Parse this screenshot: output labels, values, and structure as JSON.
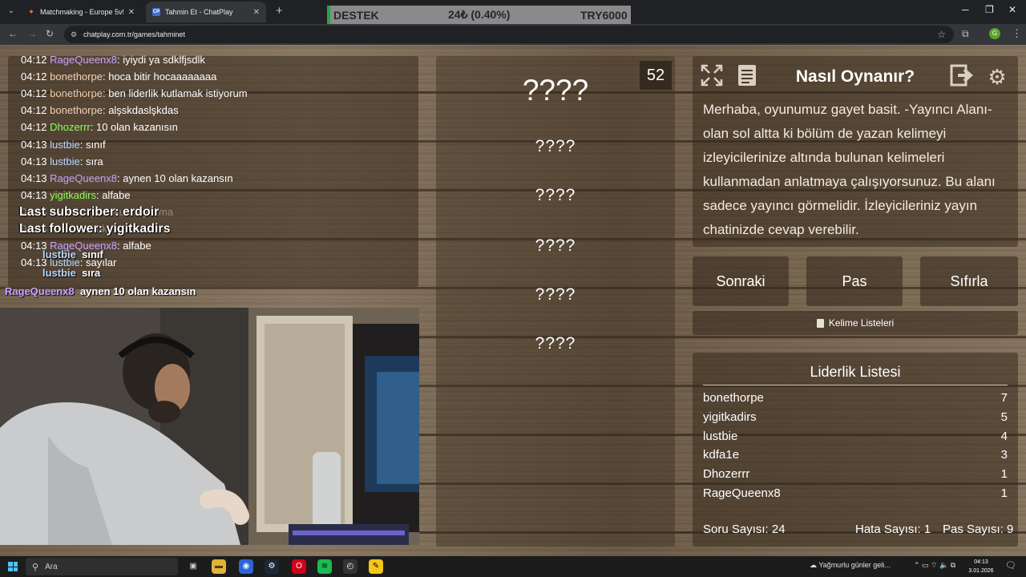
{
  "browser": {
    "tabs": [
      {
        "label": "Matchmaking - Europe 5v5 Qu",
        "favicon": "◆",
        "favicon_color": "#e46b2b"
      },
      {
        "label": "Tahmin Et - ChatPlay",
        "favicon": "CP",
        "favicon_color": "#3b6fd6"
      }
    ],
    "url": "chatplay.com.tr/games/tahminet",
    "profile_initial": "G"
  },
  "ticker": {
    "label": "DESTEK",
    "amount": "24₺ (0.40%)",
    "goal": "TRY6000"
  },
  "chat": {
    "lines": [
      {
        "time": "04:12",
        "user": "RageQueenx8",
        "color": "#c8a2ff",
        "msg": "iyiydi ya sdklfjsdlk"
      },
      {
        "time": "04:12",
        "user": "bonethorpe",
        "color": "#f0d2b6",
        "msg": "hoca bitir hocaaaaaaaa"
      },
      {
        "time": "04:12",
        "user": "bonethorpe",
        "color": "#f0d2b6",
        "msg": "ben liderlik kutlamak istiyorum"
      },
      {
        "time": "04:12",
        "user": "bonethorpe",
        "color": "#f0d2b6",
        "msg": "alşskdaslşkdas"
      },
      {
        "time": "04:12",
        "user": "Dhozerrr",
        "color": "#8cff5a",
        "msg": "10 olan kazanısın"
      },
      {
        "time": "04:13",
        "user": "lustbie",
        "color": "#b7d7ff",
        "msg": "sınıf"
      },
      {
        "time": "04:13",
        "user": "lustbie",
        "color": "#b7d7ff",
        "msg": "sıra"
      },
      {
        "time": "04:13",
        "user": "RageQueenx8",
        "color": "#c8a2ff",
        "msg": "aynen 10 olan kazansın"
      },
      {
        "time": "04:13",
        "user": "yigitkadirs",
        "color": "#8cff5a",
        "msg": "alfabe"
      },
      {
        "time": "04:13",
        "user": "bonethorpe",
        "color": "#f0d2b6",
        "msg": "okuma yazma"
      },
      {
        "time": "04:13",
        "user": "Dhozerrr",
        "color": "#8cff5a",
        "msg": "okul"
      },
      {
        "time": "04:13",
        "user": "RageQueenx8",
        "color": "#c8a2ff",
        "msg": "alfabe"
      },
      {
        "time": "04:13",
        "user": "lustbie",
        "color": "#b7d7ff",
        "msg": "sayılar"
      }
    ]
  },
  "overlay": {
    "last_subscriber": "Last subscriber: erdoir",
    "last_follower": "Last follower: yigitkadirs",
    "chat": [
      {
        "user": "lustbie",
        "color": "#b7d7ff",
        "msg": "sınıf"
      },
      {
        "user": "lustbie",
        "color": "#b7d7ff",
        "msg": "sıra"
      },
      {
        "user": "RageQueenx8",
        "color": "#c8a2ff",
        "msg": "aynen 10 olan kazansın"
      }
    ]
  },
  "game": {
    "counter": "52",
    "main_word": "????",
    "words": [
      "????",
      "????",
      "????",
      "????",
      "????"
    ]
  },
  "info": {
    "title": "Nasıl Oynanır?",
    "text": "Merhaba, oyunumuz gayet basit. -Yayıncı Alanı- olan sol altta ki bölüm de yazan kelimeyi izleyicilerinize altında bulunan kelimeleri kullanmadan anlatmaya çalışıyorsunuz. Bu alanı sadece yayıncı görmelidir. İzleyicileriniz yayın chatinizde cevap verebilir.",
    "icons": [
      "fullscreen-icon",
      "notes-icon",
      "exit-icon",
      "settings-icon"
    ]
  },
  "buttons": {
    "next": "Sonraki",
    "pass": "Pas",
    "reset": "Sıfırla",
    "word_lists": "Kelime Listeleri"
  },
  "leaderboard": {
    "title": "Liderlik Listesi",
    "rows": [
      {
        "name": "bonethorpe",
        "score": "7"
      },
      {
        "name": "yigitkadirs",
        "score": "5"
      },
      {
        "name": "lustbie",
        "score": "4"
      },
      {
        "name": "kdfa1e",
        "score": "3"
      },
      {
        "name": "Dhozerrr",
        "score": "1"
      },
      {
        "name": "RageQueenx8",
        "score": "1"
      }
    ],
    "question_count": "Soru Sayısı: 24",
    "error_count": "Hata Sayısı: 1",
    "pass_count": "Pas Sayısı: 9"
  },
  "taskbar": {
    "search_placeholder": "Ara",
    "weather": "Yağmurlu günler geli...",
    "time": "04:13",
    "date": "3.01.2026"
  }
}
